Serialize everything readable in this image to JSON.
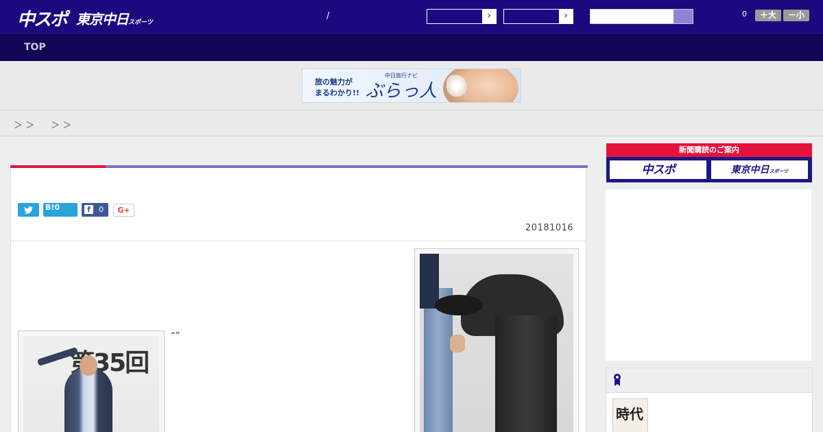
{
  "header": {
    "logo_chuspo": "中スポ",
    "logo_tokyo": "東京中日",
    "logo_tokyo_small": "スポーツ",
    "separator": "/",
    "dropdown_arrow_1": "›",
    "dropdown_arrow_2": "›",
    "search_placeholder": "",
    "font_size_value": "0",
    "font_larger_label": "＋大",
    "font_smaller_label": "－小"
  },
  "nav": {
    "top_label": "TOP"
  },
  "ad_banner": {
    "line1": "旅の魅力が",
    "line2": "まるわかり!!",
    "small": "中日旅行ナビ",
    "brand": "ぶらっ人"
  },
  "breadcrumb": {
    "sep1": "＞ ＞",
    "sep2": "＞ ＞"
  },
  "article": {
    "share": {
      "twitter_icon": "twitter-bird",
      "hatena_label": "B!",
      "hatena_count": "0",
      "facebook_letter": "f",
      "facebook_count": "0",
      "google_plus_label": "G+"
    },
    "date": "20181016",
    "quote_marks": "“”",
    "photo1_backdrop_text": "第35回"
  },
  "sidebar": {
    "subscription_header": "新聞購読のご案内",
    "subscription_chuspo": "中スポ",
    "subscription_tokyo": "東京中日",
    "subscription_tokyo_small": "スポーツ",
    "ranking_thumb_text": "時代"
  },
  "colors": {
    "header_bg": "#1a0a80",
    "nav_bg": "#110555",
    "accent_red": "#e5133b",
    "accent_purple": "#7a70c7",
    "twitter": "#2aa3de",
    "facebook": "#3c5a99"
  }
}
